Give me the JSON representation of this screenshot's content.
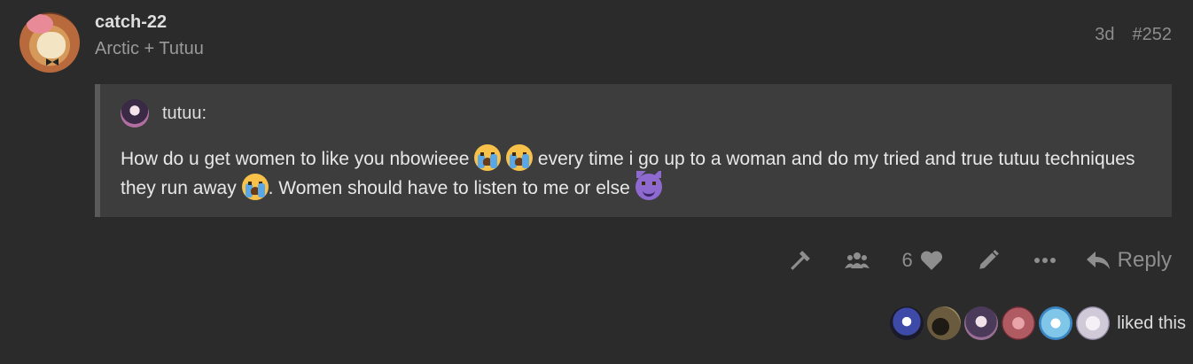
{
  "post": {
    "username": "catch-22",
    "user_title": "Arctic + Tutuu",
    "age": "3d",
    "post_number": "#252"
  },
  "quote": {
    "author": "tutuu:",
    "text_1": "How do u get women to like you nbowieee",
    "text_2": " every time i go up to a woman and do my tried and true tutuu techniques they run away",
    "text_3": ". Women should have to listen to me or else"
  },
  "actions": {
    "like_count": "6",
    "reply_label": "Reply"
  },
  "likes": {
    "label": "liked this",
    "avatar_colors": [
      "#3d4aa8",
      "#6b5b3e",
      "#4b3a5a",
      "#b05a62",
      "#7fc6e8",
      "#cfc9d8"
    ]
  },
  "icons": [
    "admin-wrench-icon",
    "group-icon",
    "heart-icon",
    "pencil-icon",
    "more-icon",
    "reply-icon"
  ]
}
